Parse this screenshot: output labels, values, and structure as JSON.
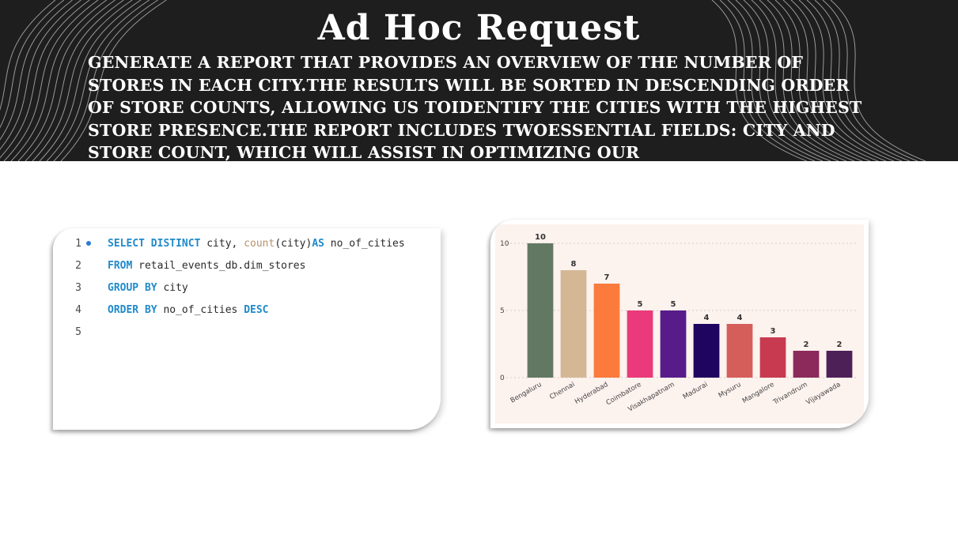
{
  "header": {
    "title": "Ad Hoc Request",
    "description": "Generate a report that provides an overview of the number of stores in each city.The results will be sorted in descending order of store counts, allowing us toidentify the cities with the highest store presence.The report includes twoessential fields: city and store count, which will assist in optimizing our retailoperations.Evaluating our pricing and promotion strategies."
  },
  "code": {
    "lines": [
      {
        "number": "1",
        "tokens": [
          {
            "t": "SELECT DISTINCT",
            "c": "kw"
          },
          {
            "t": " city, ",
            "c": ""
          },
          {
            "t": "count",
            "c": "fn"
          },
          {
            "t": "(city)",
            "c": ""
          },
          {
            "t": "AS",
            "c": "kw"
          },
          {
            "t": " no_of_cities",
            "c": ""
          }
        ]
      },
      {
        "number": "2",
        "tokens": [
          {
            "t": "FROM",
            "c": "kw"
          },
          {
            "t": " retail_events_db.dim_stores",
            "c": ""
          }
        ]
      },
      {
        "number": "3",
        "tokens": [
          {
            "t": "GROUP BY",
            "c": "kw"
          },
          {
            "t": " city",
            "c": ""
          }
        ]
      },
      {
        "number": "4",
        "tokens": [
          {
            "t": "ORDER BY",
            "c": "kw"
          },
          {
            "t": " no_of_cities ",
            "c": ""
          },
          {
            "t": "DESC",
            "c": "kw"
          }
        ]
      },
      {
        "number": "5",
        "tokens": []
      }
    ]
  },
  "chart_data": {
    "type": "bar",
    "categories": [
      "Bengaluru",
      "Chennai",
      "Hyderabad",
      "Coimbatore",
      "Visakhapatnam",
      "Madurai",
      "Mysuru",
      "Mangalore",
      "Trivandrum",
      "Vijayawada"
    ],
    "values": [
      10,
      8,
      7,
      5,
      5,
      4,
      4,
      3,
      2,
      2
    ],
    "data_labels": [
      "10",
      "8",
      "7",
      "5",
      "5",
      "4",
      "4",
      "3",
      "2",
      "2"
    ],
    "y_ticks": [
      "0",
      "5",
      "10"
    ],
    "ylim": [
      0,
      10
    ],
    "grid": true,
    "legend": "none",
    "bar_colors": [
      "#637863",
      "#d4b896",
      "#fa7b3c",
      "#ea3a7b",
      "#571c8a",
      "#1f0560",
      "#d55e5a",
      "#c83a50",
      "#8b2a5b",
      "#4d2058"
    ],
    "background": "#fcf2ee",
    "xlabel": "",
    "ylabel": "",
    "title": ""
  }
}
